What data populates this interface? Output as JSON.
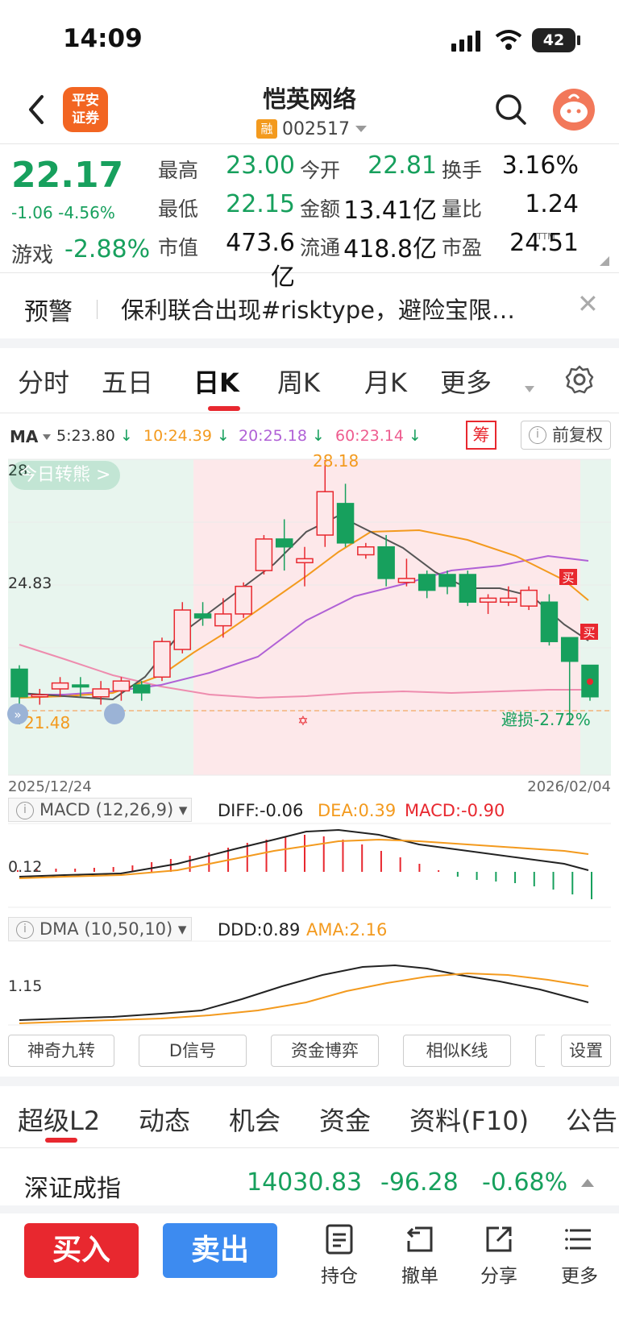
{
  "status_bar": {
    "time": "14:09",
    "battery": "42"
  },
  "header": {
    "broker_logo_lines": [
      "平安",
      "证券"
    ],
    "stock_name": "恺英网络",
    "margin_badge": "融",
    "stock_code": "002517"
  },
  "quote": {
    "price": "22.17",
    "change": "-1.06",
    "change_pct": "-4.56%",
    "sector": "游戏",
    "sector_change": "-2.88%",
    "fields": [
      {
        "label": "最高",
        "value": "23.00",
        "color": "#17a05d"
      },
      {
        "label": "今开",
        "value": "22.81",
        "color": "#17a05d"
      },
      {
        "label": "换手",
        "value": "3.16%",
        "color": "#111111"
      },
      {
        "label": "最低",
        "value": "22.15",
        "color": "#17a05d"
      },
      {
        "label": "金额",
        "value": "13.41亿",
        "color": "#111111"
      },
      {
        "label": "量比",
        "value": "1.24",
        "color": "#111111"
      },
      {
        "label": "市值",
        "value": "473.6亿",
        "color": "#111111"
      },
      {
        "label": "流通",
        "value": "418.8亿",
        "color": "#111111"
      },
      {
        "label": "市盈",
        "value": "24.51",
        "color": "#111111"
      }
    ],
    "pe_sup": "TTM"
  },
  "alert": {
    "label": "预警",
    "text": "保利联合出现#risktype，避险宝限…"
  },
  "period_tabs": [
    {
      "label": "分时",
      "active": false
    },
    {
      "label": "五日",
      "active": false
    },
    {
      "label": "日K",
      "active": true
    },
    {
      "label": "周K",
      "active": false
    },
    {
      "label": "月K",
      "active": false
    },
    {
      "label": "更多",
      "active": false
    }
  ],
  "ma_legend": {
    "name": "MA",
    "ma5": "5:23.80",
    "ma10": "10:24.39",
    "ma20": "20:25.18",
    "ma60": "60:23.14",
    "chou_label": "筹",
    "fuquan_label": "前复权"
  },
  "kline": {
    "chip_label": "今日转熊 >",
    "high_label": "28.18",
    "top_tick": "28.",
    "mid_tick": "24.83",
    "low_label": "21.48",
    "date_start": "2025/12/24",
    "date_end": "2026/02/04",
    "stoploss_label": "避损-2.72%",
    "buy_marker": "买"
  },
  "chart_data": {
    "type": "candlestick",
    "x": [
      "2025/12/24",
      "2026/02/04"
    ],
    "ylim": [
      21.48,
      28.18
    ],
    "candles": [
      {
        "o": 22.9,
        "c": 22.2,
        "h": 23.0,
        "l": 21.5
      },
      {
        "o": 22.2,
        "c": 22.25,
        "h": 22.4,
        "l": 22.0
      },
      {
        "o": 22.4,
        "c": 22.55,
        "h": 22.7,
        "l": 22.2
      },
      {
        "o": 22.5,
        "c": 22.45,
        "h": 22.7,
        "l": 22.2
      },
      {
        "o": 22.2,
        "c": 22.4,
        "h": 22.6,
        "l": 22.0
      },
      {
        "o": 22.35,
        "c": 22.6,
        "h": 22.7,
        "l": 22.1
      },
      {
        "o": 22.5,
        "c": 22.3,
        "h": 22.6,
        "l": 22.1
      },
      {
        "o": 22.7,
        "c": 23.6,
        "h": 23.7,
        "l": 22.6
      },
      {
        "o": 23.4,
        "c": 24.4,
        "h": 24.6,
        "l": 23.3
      },
      {
        "o": 24.3,
        "c": 24.2,
        "h": 24.6,
        "l": 24.0
      },
      {
        "o": 24.0,
        "c": 24.3,
        "h": 24.7,
        "l": 23.7
      },
      {
        "o": 24.3,
        "c": 25.0,
        "h": 25.1,
        "l": 24.2
      },
      {
        "o": 25.4,
        "c": 26.2,
        "h": 26.3,
        "l": 25.3
      },
      {
        "o": 26.2,
        "c": 26.0,
        "h": 26.7,
        "l": 25.4
      },
      {
        "o": 25.6,
        "c": 25.7,
        "h": 26.0,
        "l": 25.0
      },
      {
        "o": 26.3,
        "c": 27.4,
        "h": 28.2,
        "l": 26.0
      },
      {
        "o": 27.1,
        "c": 26.1,
        "h": 27.6,
        "l": 26.0
      },
      {
        "o": 25.8,
        "c": 26.0,
        "h": 26.1,
        "l": 25.7
      },
      {
        "o": 26.0,
        "c": 25.2,
        "h": 26.3,
        "l": 25.0
      },
      {
        "o": 25.1,
        "c": 25.2,
        "h": 25.7,
        "l": 25.0
      },
      {
        "o": 25.3,
        "c": 24.9,
        "h": 25.4,
        "l": 24.7
      },
      {
        "o": 25.3,
        "c": 25.0,
        "h": 25.4,
        "l": 24.8
      },
      {
        "o": 25.3,
        "c": 24.6,
        "h": 25.4,
        "l": 24.5
      },
      {
        "o": 24.6,
        "c": 24.7,
        "h": 24.8,
        "l": 24.3
      },
      {
        "o": 24.6,
        "c": 24.7,
        "h": 25.0,
        "l": 24.5
      },
      {
        "o": 24.5,
        "c": 24.9,
        "h": 25.0,
        "l": 24.4
      },
      {
        "o": 24.6,
        "c": 23.6,
        "h": 24.8,
        "l": 23.5
      },
      {
        "o": 23.7,
        "c": 23.1,
        "h": 23.7,
        "l": 21.5
      },
      {
        "o": 23.0,
        "c": 22.2,
        "h": 23.0,
        "l": 22.1
      }
    ]
  },
  "macd": {
    "label": "MACD (12,26,9)",
    "diff": "DIFF:-0.06",
    "dea": "DEA:0.39",
    "macd": "MACD:-0.90",
    "tick": "0.12"
  },
  "dma": {
    "label": "DMA (10,50,10)",
    "ddd": "DDD:0.89",
    "ama": "AMA:2.16",
    "tick": "1.15"
  },
  "tools": [
    "神奇九转",
    "D信号",
    "资金博弈",
    "相似K线",
    "设置"
  ],
  "bottom_tabs": [
    "超级L2",
    "动态",
    "机会",
    "资金",
    "资料(F10)",
    "公告"
  ],
  "index": {
    "name": "深证成指",
    "value": "14030.83",
    "change": "-96.28",
    "pct": "-0.68%"
  },
  "actions": {
    "buy": "买入",
    "sell": "卖出",
    "items": [
      "持仓",
      "撤单",
      "分享",
      "更多"
    ]
  }
}
